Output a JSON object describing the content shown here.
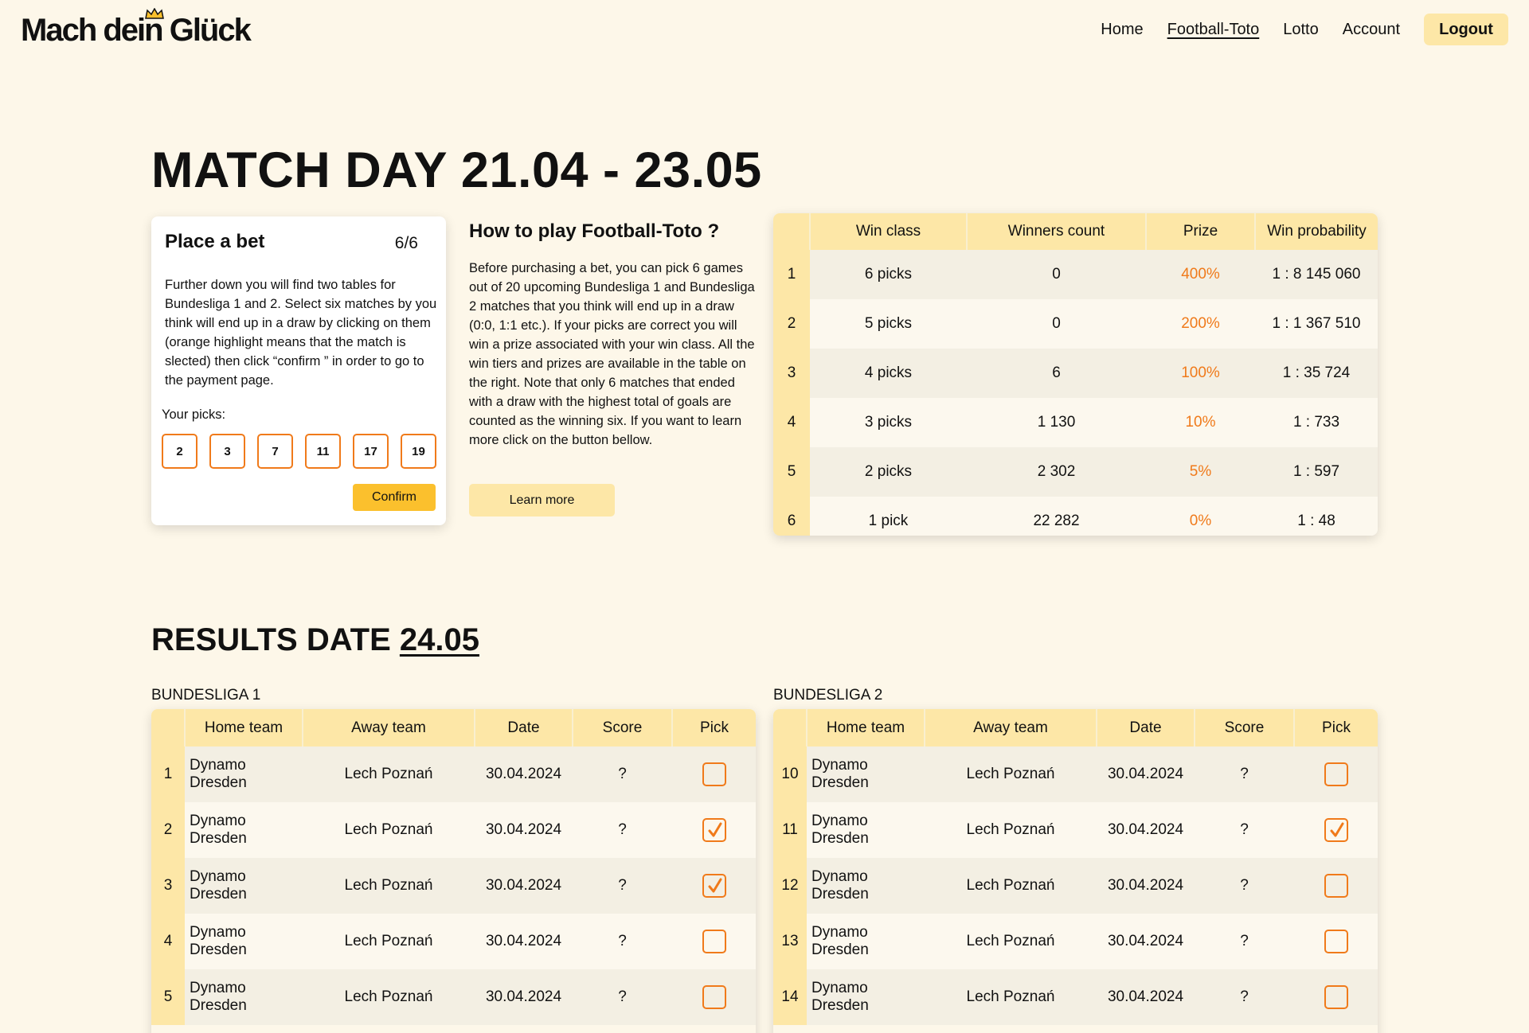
{
  "header": {
    "logo": "Mach dein Glück",
    "nav": [
      "Home",
      "Football-Toto",
      "Lotto",
      "Account"
    ],
    "logout": "Logout"
  },
  "match_day_title": "MATCH DAY 21.04 - 23.05",
  "bet": {
    "title": "Place a bet",
    "count": "6/6",
    "description": "Further down you will find two tables for Bundesliga 1 and 2. Select six matches by you think will end up in a draw by clicking on them (orange highlight means that the match is slected) then click “confirm ” in order to go to the payment page.",
    "picks_label": "Your picks:",
    "picks": [
      "2",
      "3",
      "7",
      "11",
      "17",
      "19"
    ],
    "confirm": "Confirm"
  },
  "howto": {
    "title": "How to play Football-Toto ?",
    "text": "Before purchasing a bet, you can pick 6 games out of  20 upcoming Bundesliga 1 and Bundesliga 2 matches that you think will end up in a draw (0:0, 1:1 etc.). If your picks are correct you will win a prize associated with your win class. All the win tiers and prizes are available in the table on the right. Note that only 6 matches that ended with a draw with the highest total of goals are counted as the winning six. If you want to learn more click on the button bellow.",
    "learn_more": "Learn more"
  },
  "win_table": {
    "headers": [
      "",
      "Win class",
      "Winners count",
      "Prize",
      "Win probability"
    ],
    "rows": [
      [
        "1",
        "6 picks",
        "0",
        "400%",
        "1 : 8 145 060"
      ],
      [
        "2",
        "5 picks",
        "0",
        "200%",
        "1 : 1 367 510"
      ],
      [
        "3",
        "4 picks",
        "6",
        "100%",
        "1 : 35 724"
      ],
      [
        "4",
        "3 picks",
        "1 130",
        "10%",
        "1 : 733"
      ],
      [
        "5",
        "2 picks",
        "2 302",
        "5%",
        "1 : 597"
      ],
      [
        "6",
        "1 pick",
        "22 282",
        "0%",
        "1 : 48"
      ]
    ]
  },
  "results": {
    "label": "RESULTS DATE",
    "date": "24.05"
  },
  "leagues": [
    {
      "name": "BUNDESLIGA 1",
      "headers": [
        "",
        "Home team",
        "Away team",
        "Date",
        "Score",
        "Pick"
      ],
      "rows": [
        {
          "num": "1",
          "home": "Dynamo Dresden",
          "away": "Lech Poznań",
          "date": "30.04.2024",
          "score": "?",
          "picked": false
        },
        {
          "num": "2",
          "home": "Dynamo Dresden",
          "away": "Lech Poznań",
          "date": "30.04.2024",
          "score": "?",
          "picked": true
        },
        {
          "num": "3",
          "home": "Dynamo Dresden",
          "away": "Lech Poznań",
          "date": "30.04.2024",
          "score": "?",
          "picked": true
        },
        {
          "num": "4",
          "home": "Dynamo Dresden",
          "away": "Lech Poznań",
          "date": "30.04.2024",
          "score": "?",
          "picked": false
        },
        {
          "num": "5",
          "home": "Dynamo Dresden",
          "away": "Lech Poznań",
          "date": "30.04.2024",
          "score": "?",
          "picked": false
        }
      ]
    },
    {
      "name": "BUNDESLIGA 2",
      "headers": [
        "",
        "Home team",
        "Away team",
        "Date",
        "Score",
        "Pick"
      ],
      "rows": [
        {
          "num": "10",
          "home": "Dynamo Dresden",
          "away": "Lech Poznań",
          "date": "30.04.2024",
          "score": "?",
          "picked": false
        },
        {
          "num": "11",
          "home": "Dynamo Dresden",
          "away": "Lech Poznań",
          "date": "30.04.2024",
          "score": "?",
          "picked": true
        },
        {
          "num": "12",
          "home": "Dynamo Dresden",
          "away": "Lech Poznań",
          "date": "30.04.2024",
          "score": "?",
          "picked": false
        },
        {
          "num": "13",
          "home": "Dynamo Dresden",
          "away": "Lech Poznań",
          "date": "30.04.2024",
          "score": "?",
          "picked": false
        },
        {
          "num": "14",
          "home": "Dynamo Dresden",
          "away": "Lech Poznań",
          "date": "30.04.2024",
          "score": "?",
          "picked": false
        }
      ]
    }
  ],
  "colors": {
    "background": "#fdf7e9",
    "accent_yellow": "#fde7a7",
    "confirm_yellow": "#fbc02d",
    "orange": "#f07a1a"
  }
}
